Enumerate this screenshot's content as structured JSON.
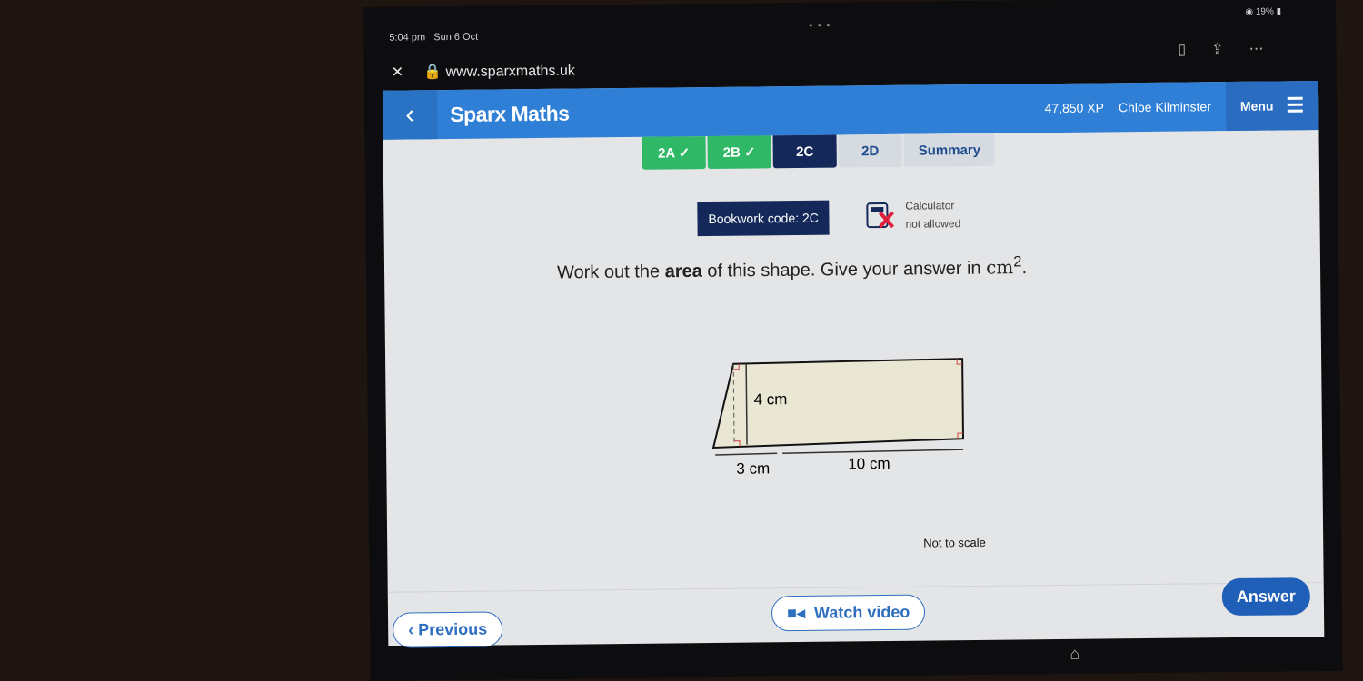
{
  "status": {
    "time": "5:04 pm",
    "date": "Sun 6 Oct",
    "battery": "19%"
  },
  "browser": {
    "url": "www.sparxmaths.uk",
    "close": "✕"
  },
  "header": {
    "brand": "Sparx Maths",
    "xp": "47,850 XP",
    "user": "Chloe Kilminster",
    "menu": "Menu"
  },
  "tabs": [
    {
      "label": "2A ✓",
      "state": "done"
    },
    {
      "label": "2B ✓",
      "state": "done"
    },
    {
      "label": "2C",
      "state": "current"
    },
    {
      "label": "2D",
      "state": "todo"
    },
    {
      "label": "Summary",
      "state": "todo"
    }
  ],
  "bookwork": "Bookwork code: 2C",
  "calculator": {
    "line1": "Calculator",
    "line2": "not allowed"
  },
  "question": {
    "pre": "Work out the ",
    "bold": "area",
    "post": " of this shape. Give your answer in ",
    "unit": "cm",
    "exp": "2",
    "end": "."
  },
  "figure": {
    "height": "4 cm",
    "left": "3 cm",
    "right": "10 cm",
    "note": "Not to scale"
  },
  "footer": {
    "previous": "Previous",
    "video": "Watch video",
    "answer": "Answer"
  }
}
